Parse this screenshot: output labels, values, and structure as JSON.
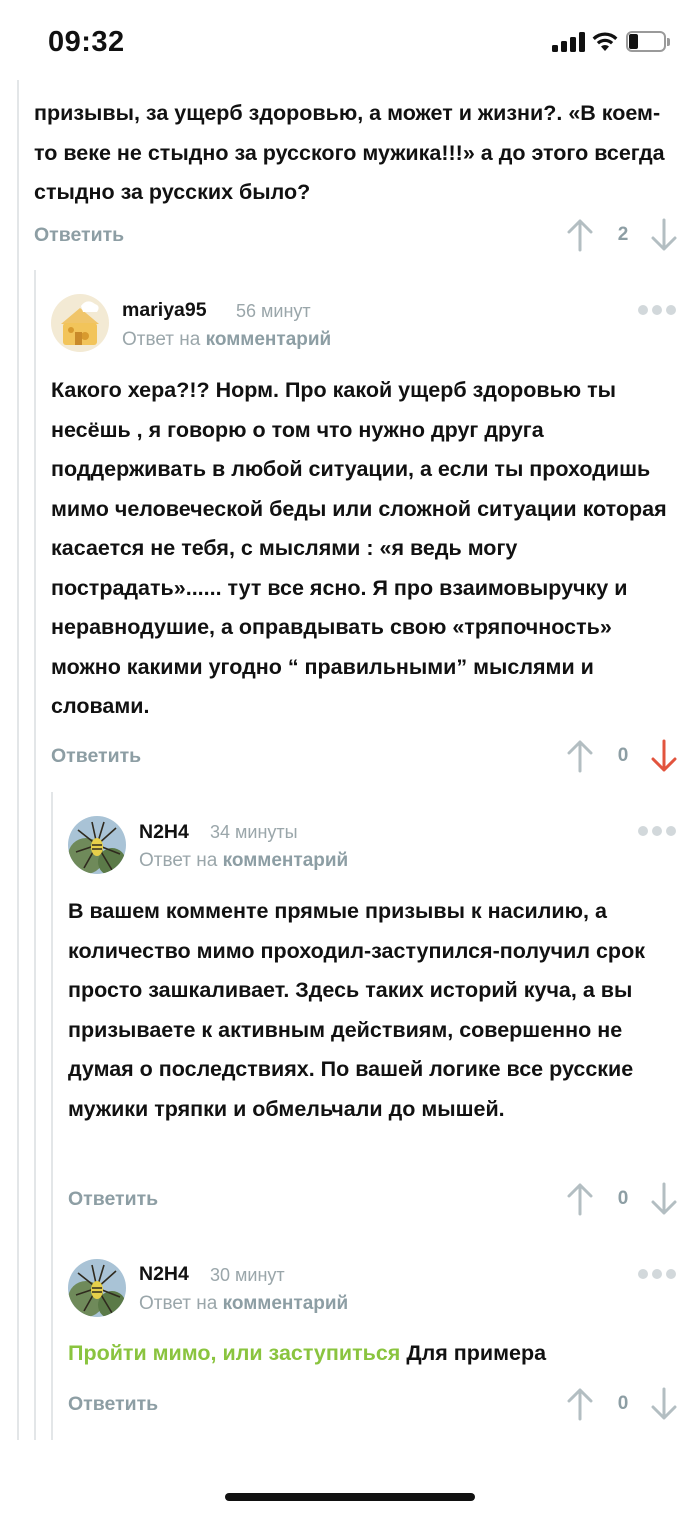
{
  "status_bar": {
    "time": "09:32"
  },
  "colors": {
    "accent_green": "#8ac43f",
    "muted": "#8d9ea4",
    "downvote_active": "#e2543e"
  },
  "comments": [
    {
      "text": "призывы, за ущерб здоровью, а может и жизни?. «В коем-то веке не стыдно за русского мужика!!!» а до этого всегда стыдно за русских было?",
      "reply_label": "Ответить",
      "votes": "2"
    },
    {
      "username": "mariya95",
      "time": "56 минут",
      "reply_to_prefix": "Ответ на",
      "reply_to_link": "комментарий",
      "text": "Какого хера?!? Норм. Про какой ущерб здоровью ты несёшь , я говорю о том что нужно друг друга поддерживать в любой ситуации, а если ты проходишь мимо человеческой беды или сложной ситуации которая касается не тебя, с мыслями : «я ведь могу пострадать»...... тут все ясно. Я про взаимовыручку и неравнодушие, а оправдывать свою «тряпочность» можно какими угодно “ правильными” мыслями и словами.",
      "reply_label": "Ответить",
      "votes": "0",
      "avatar_icon": "cheese-house-avatar"
    },
    {
      "username": "N2H4",
      "time": "34 минуты",
      "reply_to_prefix": "Ответ на",
      "reply_to_link": "комментарий",
      "text": "В вашем комменте прямые призывы к насилию, а количество мимо проходил-заступился-получил срок просто зашкаливает. Здесь таких историй куча, а вы призываете к активным действиям, совершенно не думая о последствиях. По вашей логике все русские мужики тряпки и обмельчали до мышей.",
      "reply_label": "Ответить",
      "votes": "0",
      "avatar_icon": "spider-avatar"
    },
    {
      "username": "N2H4",
      "time": "30 минут",
      "reply_to_prefix": "Ответ на",
      "reply_to_link": "комментарий",
      "link_text": "Пройти мимо, или заступиться",
      "text_after_link": " Для примера",
      "reply_label": "Ответить",
      "votes": "0",
      "avatar_icon": "spider-avatar"
    }
  ]
}
